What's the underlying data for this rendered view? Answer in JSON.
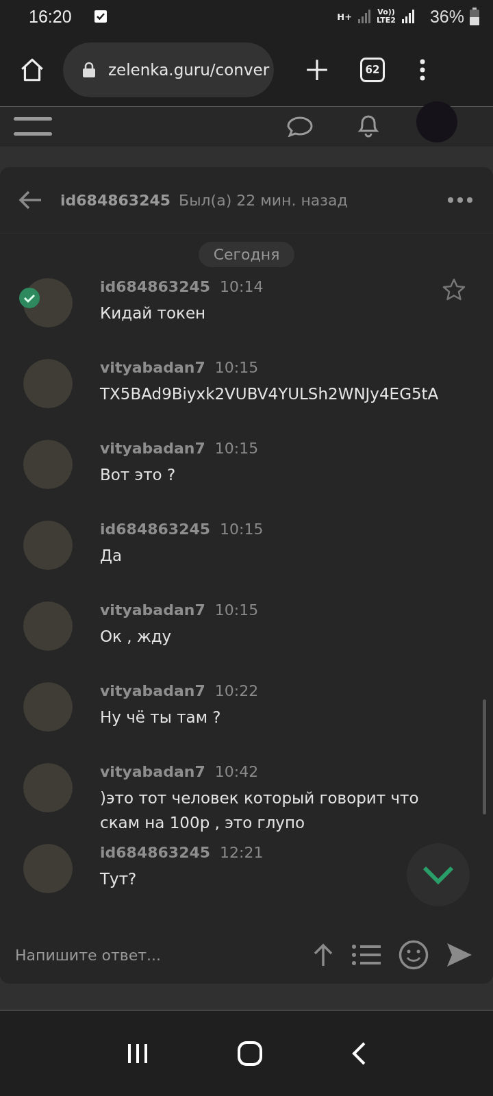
{
  "status_bar": {
    "time": "16:20",
    "network": "H+",
    "volte": "Vo))",
    "lte": "LTE2",
    "battery": "36%"
  },
  "browser": {
    "url": "zelenka.guru/conver",
    "tab_count": "62"
  },
  "conversation": {
    "title": "id684863245",
    "last_seen": "Был(а) 22 мин. назад",
    "date_divider": "Сегодня",
    "messages": [
      {
        "author": "id684863245",
        "time": "10:14",
        "text": "Кидай токен",
        "verified": true,
        "starred": false
      },
      {
        "author": "vityabadan7",
        "time": "10:15",
        "text": "TX5BAd9Biyxk2VUBV4YULSh2WNJy4EG5tA",
        "verified": false
      },
      {
        "author": "vityabadan7",
        "time": "10:15",
        "text": "Вот это ?",
        "verified": false
      },
      {
        "author": "id684863245",
        "time": "10:15",
        "text": "Да",
        "verified": false
      },
      {
        "author": "vityabadan7",
        "time": "10:15",
        "text": "Ок , жду",
        "verified": false
      },
      {
        "author": "vityabadan7",
        "time": "10:22",
        "text": "Ну чё ты там ?",
        "verified": false
      },
      {
        "author": "vityabadan7",
        "time": "10:42",
        "text": ")это тот человек который говорит что скам на 100р , это глупо",
        "verified": false
      },
      {
        "author": "id684863245",
        "time": "12:21",
        "text": "Тут?",
        "verified": false
      }
    ],
    "reply": {
      "placeholder": "Напишите ответ..."
    }
  }
}
